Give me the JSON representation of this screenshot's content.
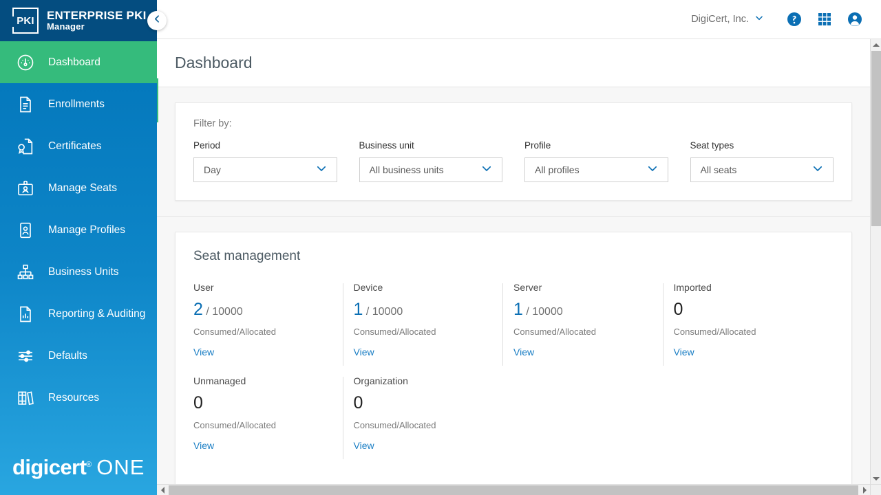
{
  "brand": {
    "mark": "PKI",
    "title": "ENTERPRISE PKI",
    "subtitle": "Manager",
    "footer_logo_main": "digicert",
    "footer_logo_reg": "®",
    "footer_logo_secondary": "ONE"
  },
  "sidebar": {
    "collapse_icon": "chevron-left-icon",
    "items": [
      {
        "label": "Dashboard",
        "icon": "gauge-icon",
        "active": true
      },
      {
        "label": "Enrollments",
        "icon": "document-lines-icon",
        "active": false
      },
      {
        "label": "Certificates",
        "icon": "certificate-seal-icon",
        "active": false
      },
      {
        "label": "Manage Seats",
        "icon": "id-badge-icon",
        "active": false
      },
      {
        "label": "Manage Profiles",
        "icon": "id-card-person-icon",
        "active": false
      },
      {
        "label": "Business Units",
        "icon": "org-chart-icon",
        "active": false
      },
      {
        "label": "Reporting & Auditing",
        "icon": "document-chart-icon",
        "active": false
      },
      {
        "label": "Defaults",
        "icon": "sliders-icon",
        "active": false
      },
      {
        "label": "Resources",
        "icon": "books-icon",
        "active": false
      }
    ]
  },
  "topbar": {
    "organization": "DigiCert, Inc.",
    "organization_chevron": "chevron-down-icon",
    "help_icon": "help-circle-icon",
    "apps_icon": "app-grid-icon",
    "account_icon": "user-account-icon"
  },
  "page": {
    "title": "Dashboard"
  },
  "filter": {
    "heading": "Filter by:",
    "fields": [
      {
        "label": "Period",
        "value": "Day",
        "icon": "chevron-down-icon"
      },
      {
        "label": "Business unit",
        "value": "All business units",
        "icon": "chevron-down-icon"
      },
      {
        "label": "Profile",
        "value": "All profiles",
        "icon": "chevron-down-icon"
      },
      {
        "label": "Seat types",
        "value": "All seats",
        "icon": "chevron-down-icon"
      }
    ]
  },
  "seat_management": {
    "title": "Seat management",
    "sub_label": "Consumed/Allocated",
    "link_label": "View",
    "cells": [
      {
        "name": "User",
        "consumed": "2",
        "allocated": "/ 10000",
        "has_total": true,
        "divided": false
      },
      {
        "name": "Device",
        "consumed": "1",
        "allocated": "/ 10000",
        "has_total": true,
        "divided": true
      },
      {
        "name": "Server",
        "consumed": "1",
        "allocated": "/ 10000",
        "has_total": true,
        "divided": true
      },
      {
        "name": "Imported",
        "consumed": "0",
        "allocated": "",
        "has_total": false,
        "divided": true
      },
      {
        "name": "Unmanaged",
        "consumed": "0",
        "allocated": "",
        "has_total": false,
        "divided": false
      },
      {
        "name": "Organization",
        "consumed": "0",
        "allocated": "",
        "has_total": false,
        "divided": true
      }
    ]
  },
  "scrollbars": {
    "vertical_up_icon": "triangle-up-icon",
    "vertical_down_icon": "triangle-down-icon",
    "horizontal_left_icon": "triangle-left-icon",
    "horizontal_right_icon": "triangle-right-icon"
  },
  "colors": {
    "brand_dark_blue": "#044d80",
    "sidebar_top": "#0073b8",
    "sidebar_bottom": "#29a6e0",
    "active_green": "#35bb7c",
    "accent_blue": "#0b6fb4",
    "link_blue": "#1a7ec4",
    "page_bg": "#f7f7f7"
  }
}
